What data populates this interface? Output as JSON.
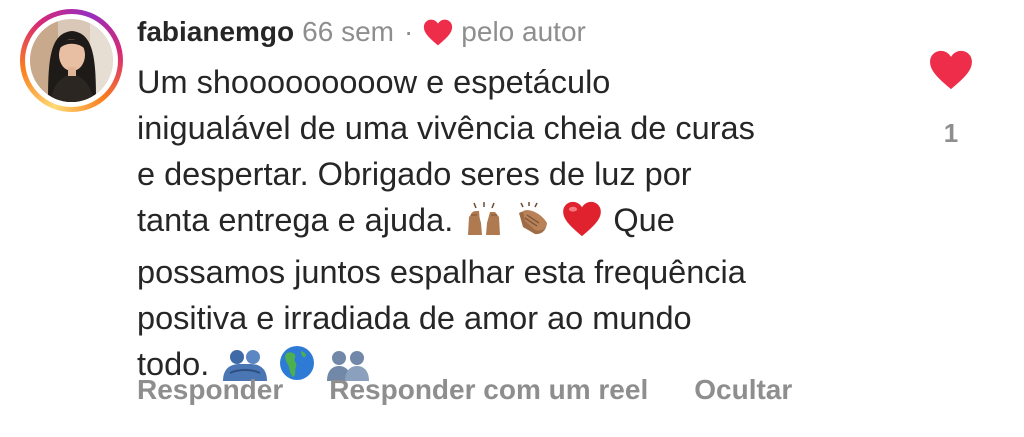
{
  "comment": {
    "username": "fabianemgo",
    "time": "66 sem",
    "separator": "·",
    "author_label": "pelo autor",
    "lines": [
      "Um shooooooooow e espetáculo",
      "inigualável de uma vivência cheia de curas",
      "e despertar. Obrigado seres de luz por",
      "tanta entrega e ajuda.",
      "Que",
      "possamos juntos espalhar esta frequência",
      "positiva e irradiada de amor ao mundo",
      "todo."
    ],
    "emojis_line4": [
      "raising-hands-emoji",
      "clapping-hands-emoji",
      "red-heart-emoji"
    ],
    "emojis_line8": [
      "people-hugging-emoji",
      "globe-americas-emoji",
      "busts-in-silhouette-emoji"
    ]
  },
  "actions": {
    "reply": "Responder",
    "reply_reel": "Responder com um reel",
    "hide": "Ocultar"
  },
  "likes": {
    "count": "1"
  },
  "colors": {
    "heart": "#ed2d4a",
    "text": "#262626",
    "muted": "#8e8e8e"
  }
}
